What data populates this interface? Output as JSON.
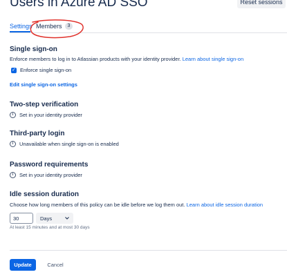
{
  "page": {
    "title": "Users in Azure AD SSO"
  },
  "header": {
    "reset_label": "Reset sessions"
  },
  "tabs": [
    {
      "label": "Settings",
      "active": true
    },
    {
      "label": "Members",
      "count": "3",
      "active": false
    }
  ],
  "sso": {
    "heading": "Single sign-on",
    "description": "Enforce members to log in to Atlassian products with your identity provider.",
    "learn_link": "Learn about single sign-on",
    "checkbox_label": "Enforce single sign-on",
    "checked": true,
    "edit_link": "Edit single sign-on settings"
  },
  "two_step": {
    "heading": "Two-step verification",
    "info": "Set in your identity provider"
  },
  "third_party": {
    "heading": "Third-party login",
    "info": "Unavailable when single sign-on is enabled"
  },
  "password": {
    "heading": "Password requirements",
    "info": "Set in your identity provider"
  },
  "idle": {
    "heading": "Idle session duration",
    "description": "Choose how long members of this policy can be idle before we log them out.",
    "learn_link": "Learn about idle session duration",
    "value": "30",
    "unit": "Days",
    "hint": "At least 15 minutes and at most 30 days"
  },
  "footer": {
    "update_label": "Update",
    "cancel_label": "Cancel"
  },
  "colors": {
    "accent": "#0c66e4",
    "text": "#172b4d",
    "annotation": "#e0302a"
  },
  "icons": [
    "info-icon",
    "check-icon",
    "chevron-down-icon"
  ]
}
